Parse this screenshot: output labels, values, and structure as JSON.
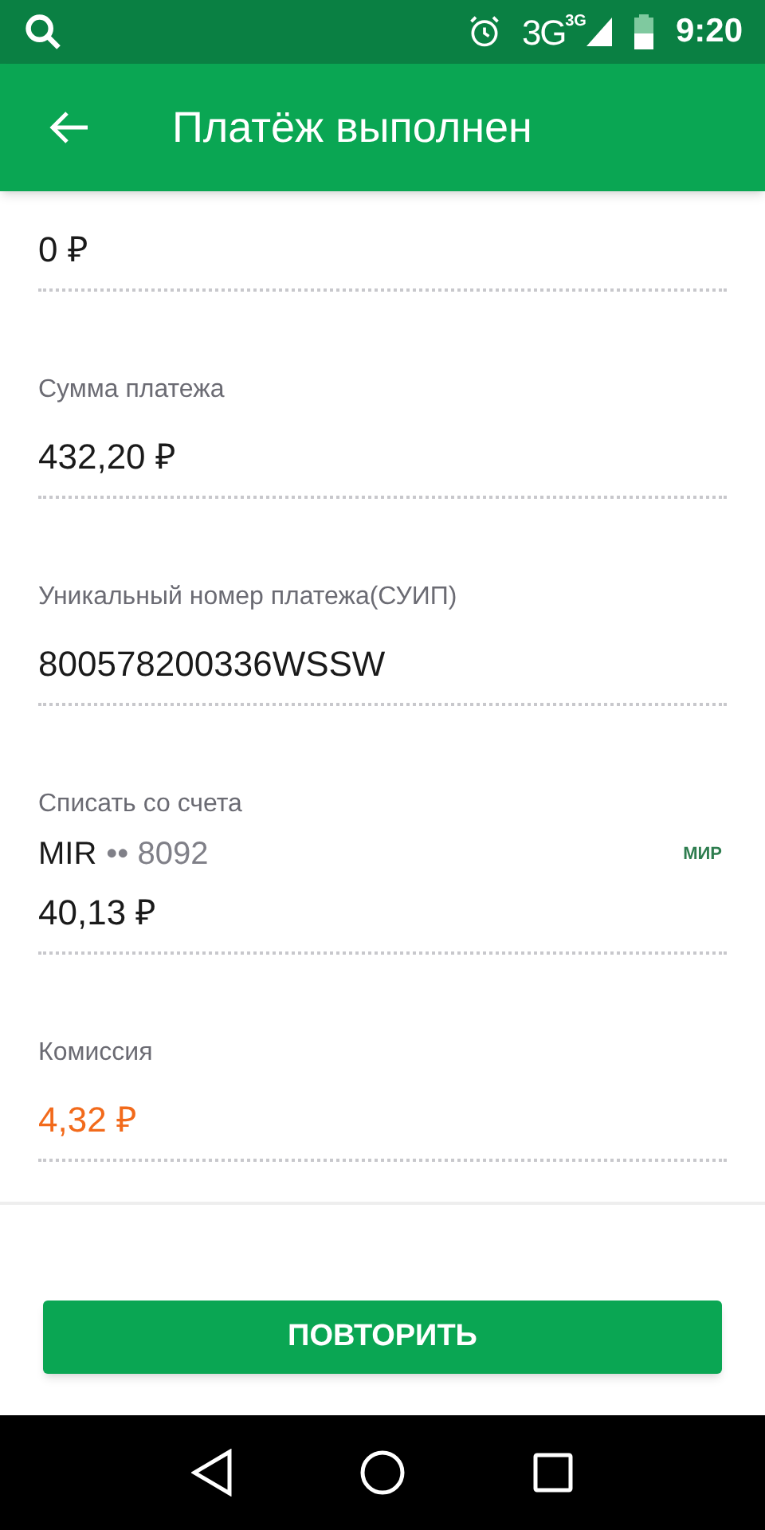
{
  "status_bar": {
    "network": "3G",
    "network_small": "3G",
    "time": "9:20"
  },
  "header": {
    "title": "Платёж выполнен"
  },
  "fields": [
    {
      "kind": "amount",
      "value": "0 ₽",
      "highlight": false
    },
    {
      "kind": "amount",
      "label": "Сумма платежа",
      "value": "432,20 ₽",
      "highlight": false
    },
    {
      "kind": "amount",
      "label": "Уникальный номер платежа(СУИП)",
      "value": "800578200336WSSW",
      "highlight": false
    },
    {
      "kind": "card",
      "label": "Списать со счета",
      "card_name": "MIR",
      "card_mask": "•• 8092",
      "card_logo": "МИР",
      "value": "40,13 ₽",
      "highlight": false
    },
    {
      "kind": "amount",
      "label": "Комиссия",
      "value": "4,32 ₽",
      "highlight": true
    }
  ],
  "button": {
    "label": "ПОВТОРИТЬ"
  }
}
